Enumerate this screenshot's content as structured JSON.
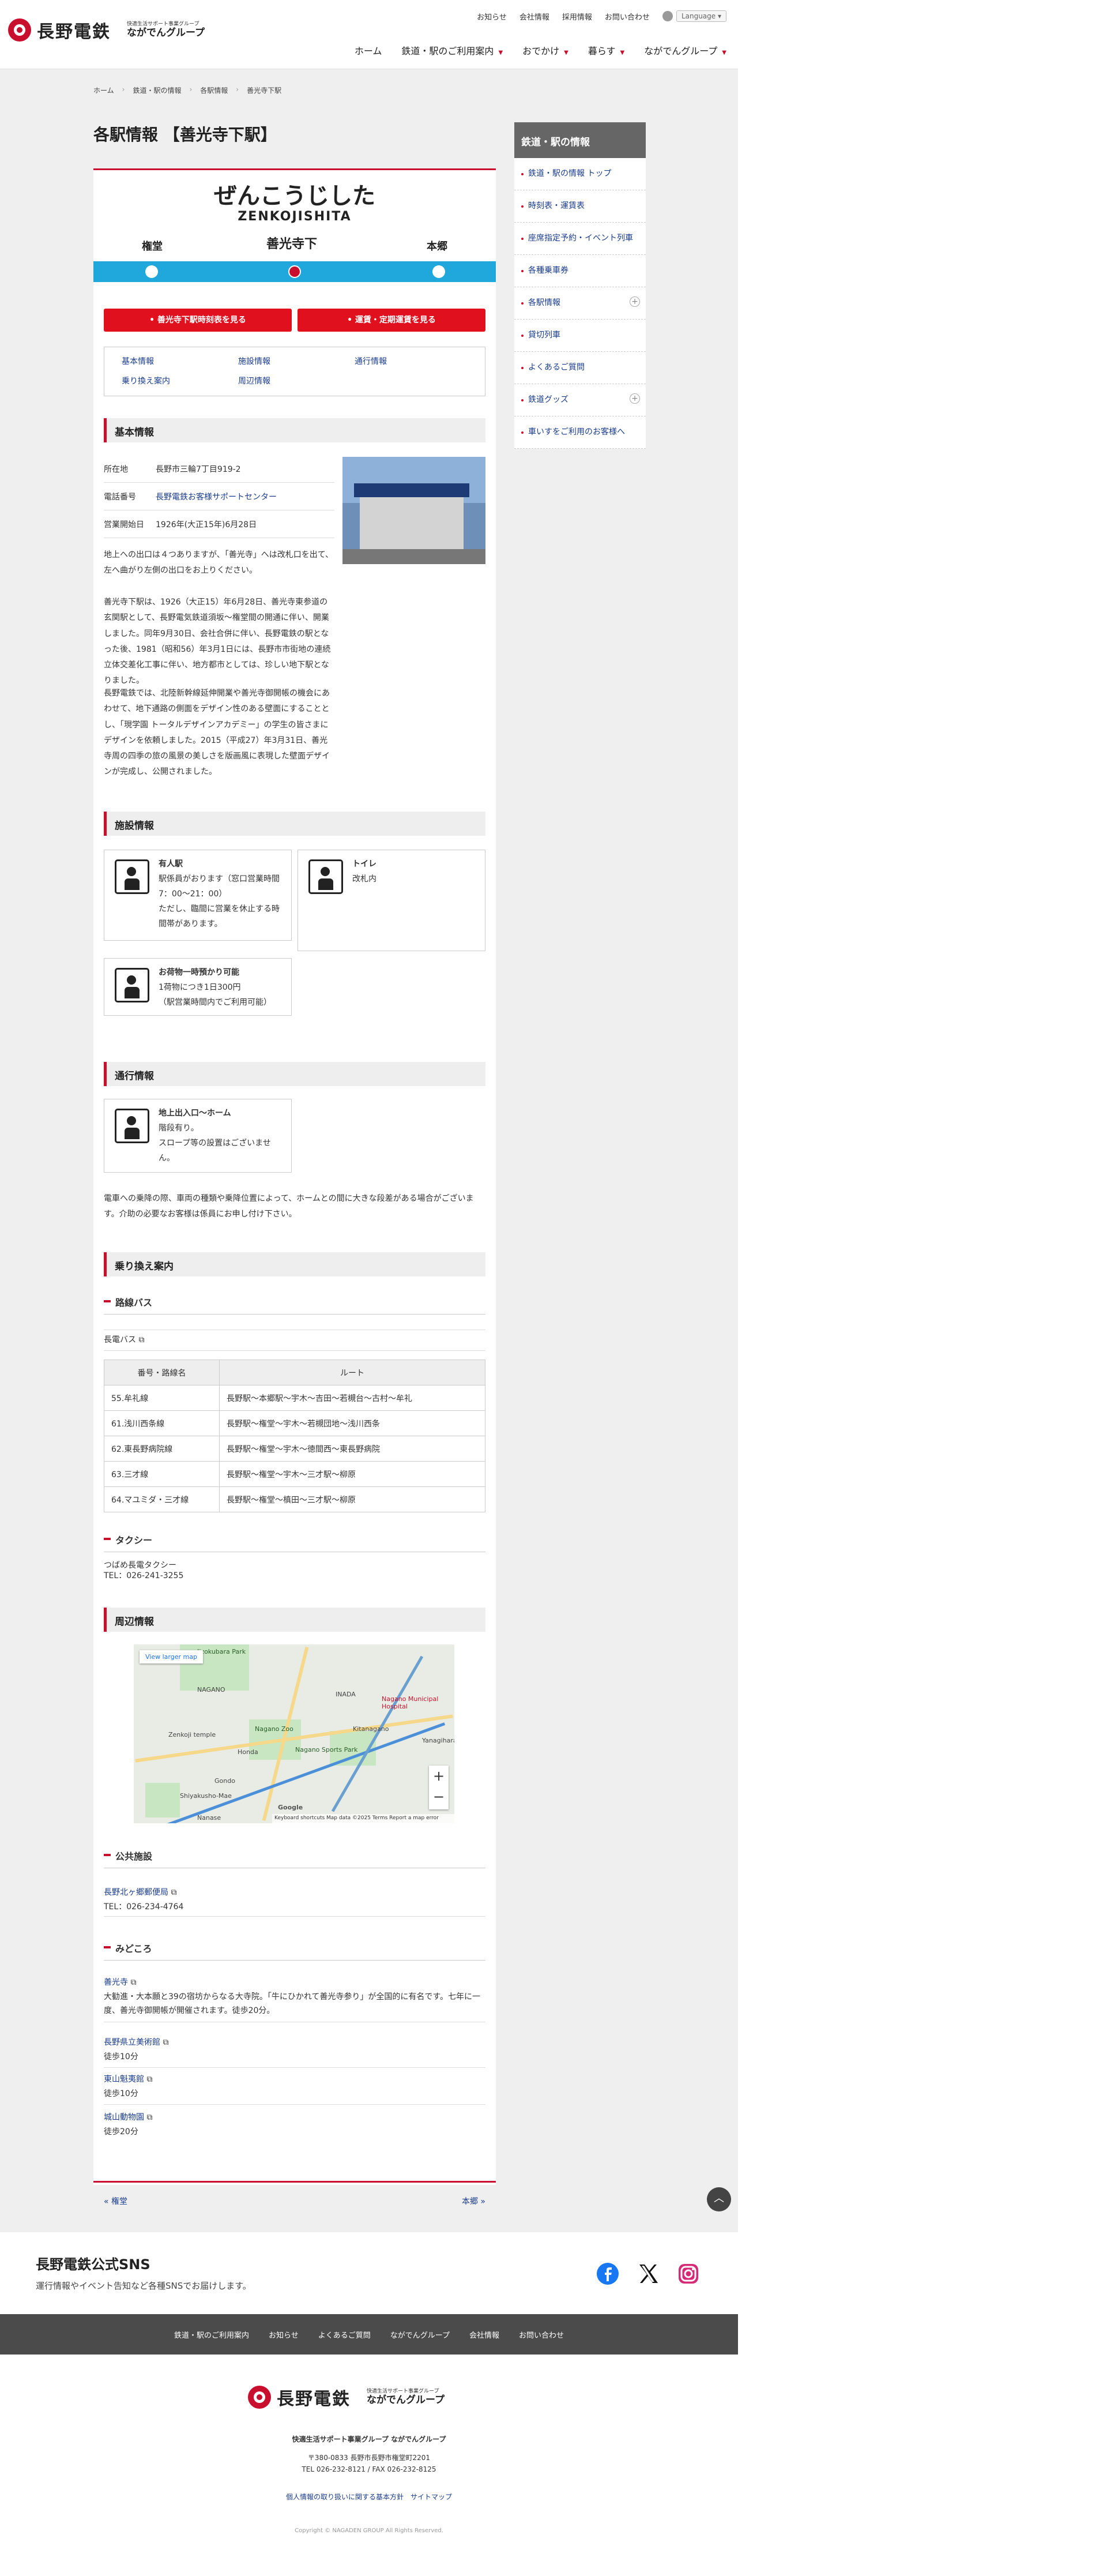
{
  "header": {
    "logo_name": "長野電鉄",
    "group_small": "快適生活サポート事業グループ",
    "group_name": "ながでんグループ",
    "util": [
      "お知らせ",
      "会社情報",
      "採用情報",
      "お問い合わせ"
    ],
    "language": "Language ▾",
    "nav": [
      "ホーム",
      "鉄道・駅のご利用案内",
      "おでかけ",
      "暮らす",
      "ながでんグループ"
    ]
  },
  "breadcrumb": [
    "ホーム",
    "鉄道・駅の情報",
    "各駅情報",
    "善光寺下駅"
  ],
  "page_title": "各駅情報 【善光寺下駅】",
  "station": {
    "kana": "ぜんこうじした",
    "romaji": "ZENKOJISHITA",
    "prev": "権堂",
    "current": "善光寺下",
    "next": "本郷"
  },
  "buttons": {
    "timetable": "善光寺下駅時刻表を見る",
    "fare": "運賃・定期運賃を見る"
  },
  "anchors": [
    "基本情報",
    "施設情報",
    "通行情報",
    "乗り換え案内",
    "周辺情報"
  ],
  "basic": {
    "heading": "基本情報",
    "rows": [
      {
        "k": "所在地",
        "v": "長野市三輪7丁目919-2"
      },
      {
        "k": "電話番号",
        "v": "長野電鉄お客様サポートセンター"
      },
      {
        "k": "営業開始日",
        "v": "1926年(大正15年)6月28日"
      }
    ],
    "p1": "地上への出口は４つありますが、「善光寺」へは改札口を出て、左へ曲がり左側の出口をお上りください。",
    "p2": "善光寺下駅は、1926（大正15）年6月28日、善光寺東参道の玄関駅として、長野電気鉄道須坂～権堂間の開通に伴い、開業しました。同年9月30日、会社合併に伴い、長野電鉄の駅となった後、1981（昭和56）年3月1日には、長野市市街地の連続立体交差化工事に伴い、地方都市としては、珍しい地下駅となりました。",
    "p3": "長野電鉄では、北陸新幹線延伸開業や善光寺御開帳の機会にあわせて、地下通路の側面をデザイン性のある壁面にすることとし、「現学園 トータルデザインアカデミー」の学生の皆さまにデザインを依頼しました。2015（平成27）年3月31日、善光寺周の四季の旅の風景の美しさを版画風に表現した壁面デザインが完成し、公開されました。"
  },
  "facility": {
    "heading": "施設情報",
    "items": [
      {
        "icon": "station-staff-icon",
        "title": "有人駅",
        "body": "駅係員がおります（窓口営業時間7：00～21：00）\nただし、臨間に営業を休止する時間帯があります。"
      },
      {
        "icon": "toilet-icon",
        "title": "トイレ",
        "body": "改札内"
      },
      {
        "icon": "luggage-icon",
        "title": "お荷物一時預かり可能",
        "body": "1荷物につき1日300円\n（駅営業時間内でご利用可能）"
      }
    ]
  },
  "access": {
    "heading": "通行情報",
    "title": "地上出入口～ホーム",
    "body": "階段有り。\nスロープ等の設置はございません。",
    "note": "電車への乗降の際、車両の種類や乗降位置によって、ホームとの間に大きな段差がある場合がございます。介助の必要なお客様は係員にお申し付け下さい。"
  },
  "transfer": {
    "heading": "乗り換え案内",
    "bus_heading": "路線バス",
    "bus_link": "長電バス",
    "table_headers": [
      "番号・路線名",
      "ルート"
    ],
    "rows": [
      [
        "55.牟礼線",
        "長野駅～本郷駅～宇木～吉田～若槻台～古村～牟礼"
      ],
      [
        "61.浅川西条線",
        "長野駅～権堂～宇木～若槻団地～浅川西条"
      ],
      [
        "62.東長野病院線",
        "長野駅～権堂～宇木～徳間西～東長野病院"
      ],
      [
        "63.三才線",
        "長野駅～権堂～宇木～三才駅～柳原"
      ],
      [
        "64.マユミダ・三才線",
        "長野駅～権堂～槙田～三才駅～柳原"
      ]
    ],
    "taxi_heading": "タクシー",
    "taxi_link": "つばめ長電タクシー",
    "taxi_tel": "TEL：026-241-3255"
  },
  "surroundings": {
    "heading": "周辺情報",
    "map_view": "View larger map",
    "map_footer": "Keyboard shortcuts   Map data ©2025   Terms   Report a map error",
    "map_labels": [
      "Jizokubara Park",
      "NAGANO",
      "INADA",
      "Nagano Zoo",
      "Zenkoji temple",
      "Honda",
      "Kitanagano",
      "Nagano Sports Park",
      "Gondo",
      "Shiyakusho-Mae",
      "Nagano Municipal Hospital",
      "Yanagihara",
      "Nanase",
      "Google"
    ],
    "public_heading": "公共施設",
    "public": [
      {
        "name": "長野北ヶ郷郵便局",
        "detail": "TEL：026-234-4764"
      }
    ],
    "spots_heading": "みどころ",
    "spots": [
      {
        "name": "善光寺",
        "detail": "大勧進・大本願と39の宿坊からなる大寺院。「牛にひかれて善光寺参り」が全国的に有名です。七年に一度、善光寺御開帳が開催されます。徒歩20分。"
      },
      {
        "name": "長野県立美術館",
        "detail": "徒歩10分"
      },
      {
        "name": "東山魁夷館",
        "detail": "徒歩10分"
      },
      {
        "name": "城山動物園",
        "detail": "徒歩20分"
      }
    ]
  },
  "pager": {
    "prev": "« 権堂",
    "next": "本郷 »"
  },
  "sidebar": {
    "heading": "鉄道・駅の情報",
    "items": [
      "鉄道・駅の情報 トップ",
      "時刻表・運賃表",
      "座席指定予約・イベント列車",
      "各種乗車券",
      "各駅情報",
      "貸切列車",
      "よくあるご質問",
      "鉄道グッズ",
      "車いすをご利用のお客様へ"
    ]
  },
  "sns": {
    "title": "長野電鉄公式SNS",
    "desc": "運行情報やイベント告知など各種SNSでお届けします。"
  },
  "footer_nav": [
    "鉄道・駅のご利用案内",
    "お知らせ",
    "よくあるご質問",
    "ながでんグループ",
    "会社情報",
    "お問い合わせ"
  ],
  "footer": {
    "group": "快適生活サポート事業グループ ながでんグループ",
    "address": "〒380-0833 長野市長野市権堂町2201",
    "tel": "TEL 026-232-8121 / FAX 026-232-8125",
    "privacy": "個人情報の取り扱いに関する基本方針",
    "sitemap": "サイトマップ",
    "copyright": "Copyright © NAGADEN GROUP All Rights Reserved."
  },
  "colors": {
    "accent": "#c8102e",
    "line": "#20a8dc",
    "button": "#e0101e"
  }
}
